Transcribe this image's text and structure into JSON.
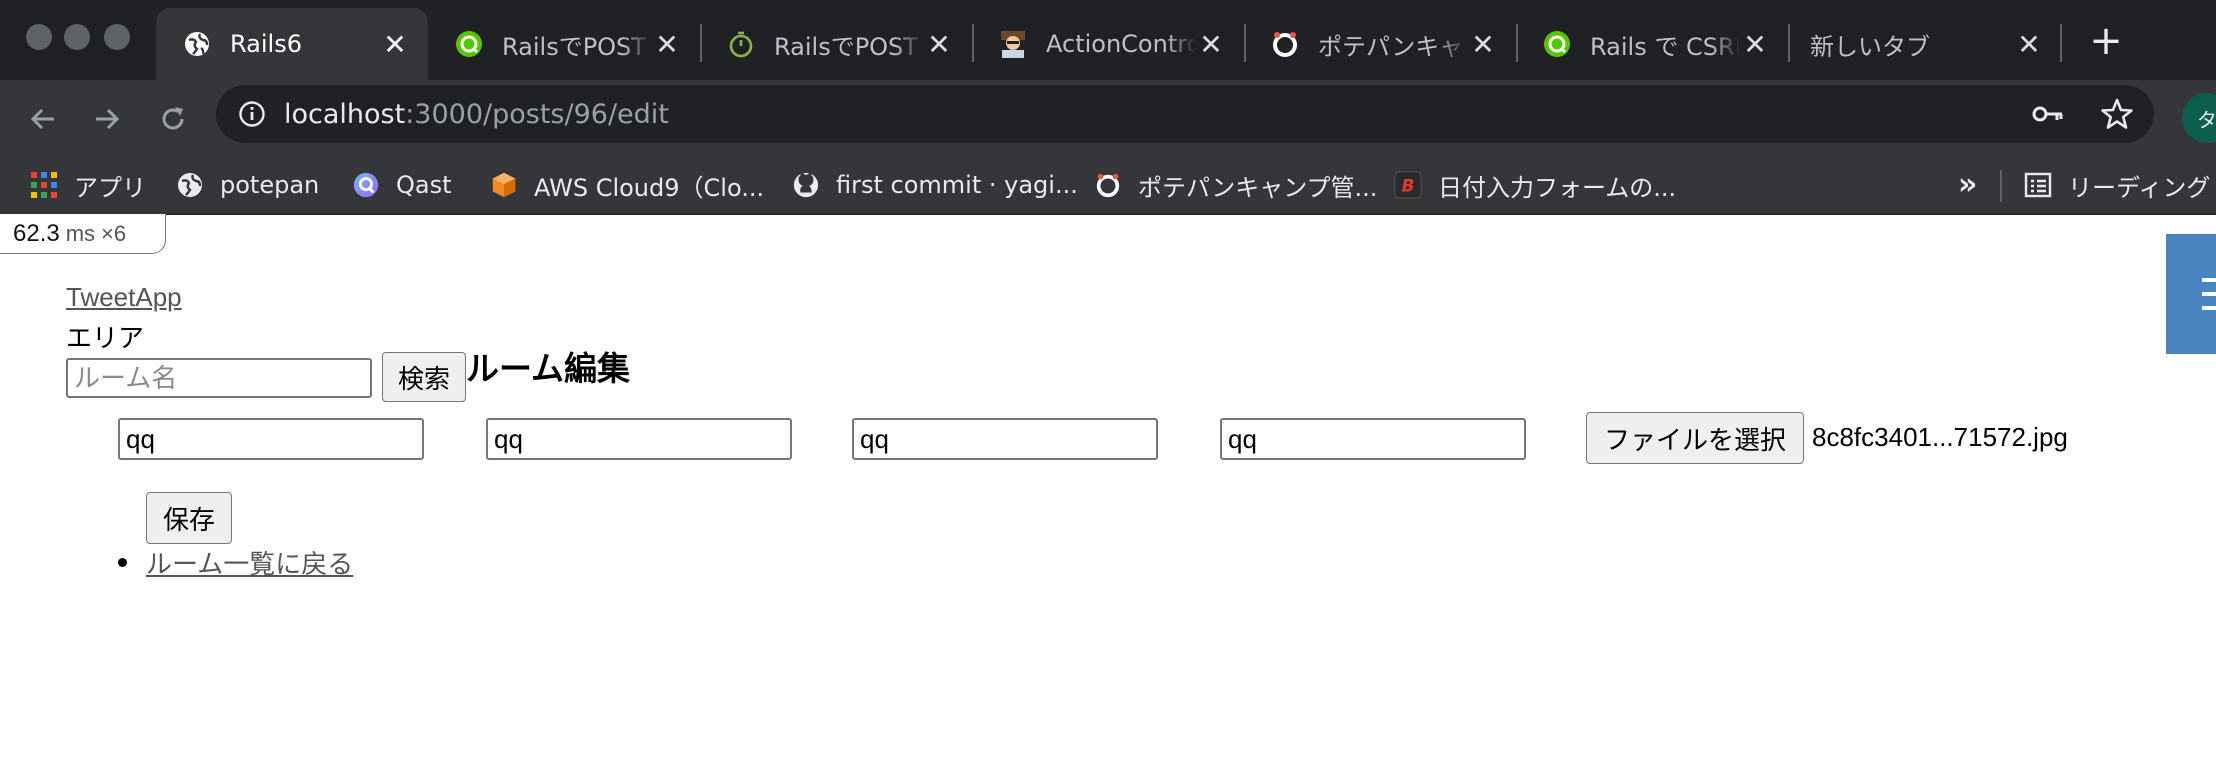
{
  "browser": {
    "tabs": [
      {
        "title": "Rails6",
        "icon": "globe-icon",
        "active": true
      },
      {
        "title": "RailsでPOST",
        "icon": "qiita-icon"
      },
      {
        "title": "RailsでPOST",
        "icon": "timer-icon"
      },
      {
        "title": "ActionContro",
        "icon": "avatar-icon"
      },
      {
        "title": "ポテパンキャン",
        "icon": "potepan-icon"
      },
      {
        "title": "Rails で CSRF",
        "icon": "qiita-icon"
      },
      {
        "title": "新しいタブ",
        "icon": ""
      }
    ],
    "new_tab_label": "+",
    "url_host": "localhost",
    "url_path": ":3000/posts/96/edit",
    "profile_initial": "タ",
    "bookmarks": [
      {
        "label": "アプリ",
        "icon": "apps-grid-icon"
      },
      {
        "label": "potepan",
        "icon": "globe-icon"
      },
      {
        "label": "Qast",
        "icon": "qast-icon"
      },
      {
        "label": "AWS Cloud9（Clo...",
        "icon": "cube-icon"
      },
      {
        "label": "first commit · yagi...",
        "icon": "github-icon"
      },
      {
        "label": "ポテパンキャンプ管...",
        "icon": "potepan-icon"
      },
      {
        "label": "日付入力フォームの...",
        "icon": "hatena-bookmark-icon"
      }
    ],
    "bookmarks_more": "»",
    "reading_list": "リーディング"
  },
  "profiler": {
    "time": "62.3",
    "unit": "ms",
    "count": "×6"
  },
  "page": {
    "brand": "TweetApp",
    "area_label": "エリア",
    "search_placeholder": "ルーム名",
    "search_button": "検索",
    "heading": "ルーム編集",
    "fields": [
      "qq",
      "qq",
      "qq",
      "qq"
    ],
    "file_button": "ファイルを選択",
    "file_name": "8c8fc3401...71572.jpg",
    "save_button": "保存",
    "back_link": "ルーム一覧に戻る"
  },
  "colors": {
    "tab_strip": "#202124",
    "toolbar": "#35363a",
    "side_tab": "#4a84c0",
    "qiita_green": "#55c500",
    "potepan_red": "#e8574a"
  }
}
